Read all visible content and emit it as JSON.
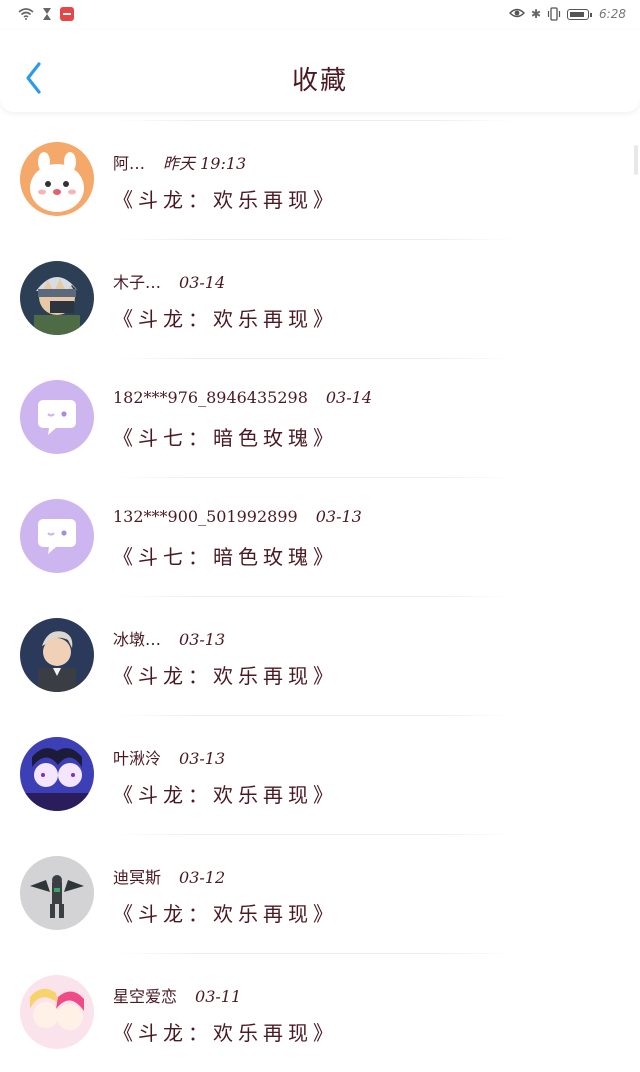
{
  "status_bar": {
    "time": "6:28",
    "bluetooth": "✱"
  },
  "header": {
    "title": "收藏",
    "back_icon": "chevron-left-icon",
    "accent": "#2f9be8"
  },
  "items": [
    {
      "name": "阿…",
      "date": "昨天 19:13",
      "text": "《斗龙：欢乐再现》",
      "avatar": "cartoon-bunny"
    },
    {
      "name": "木子…",
      "date": "03-14",
      "text": "《斗龙：欢乐再现》",
      "avatar": "anime-ninja"
    },
    {
      "name": "182***976_8946435298",
      "date": "03-14",
      "text": "《斗七：暗色玫瑰》",
      "avatar": "default-chat"
    },
    {
      "name": "132***900_501992899",
      "date": "03-13",
      "text": "《斗七：暗色玫瑰》",
      "avatar": "default-chat"
    },
    {
      "name": "冰墩…",
      "date": "03-13",
      "text": "《斗龙：欢乐再现》",
      "avatar": "3d-character"
    },
    {
      "name": "叶湫泠",
      "date": "03-13",
      "text": "《斗龙：欢乐再现》",
      "avatar": "anime-girls"
    },
    {
      "name": "迪冥斯",
      "date": "03-12",
      "text": "《斗龙：欢乐再现》",
      "avatar": "mecha-robot"
    },
    {
      "name": "星空爱恋",
      "date": "03-11",
      "text": "《斗龙：欢乐再现》",
      "avatar": "anime-pink"
    }
  ],
  "colors": {
    "text": "#4a1a22",
    "default_avatar": "#cdb5f0"
  }
}
